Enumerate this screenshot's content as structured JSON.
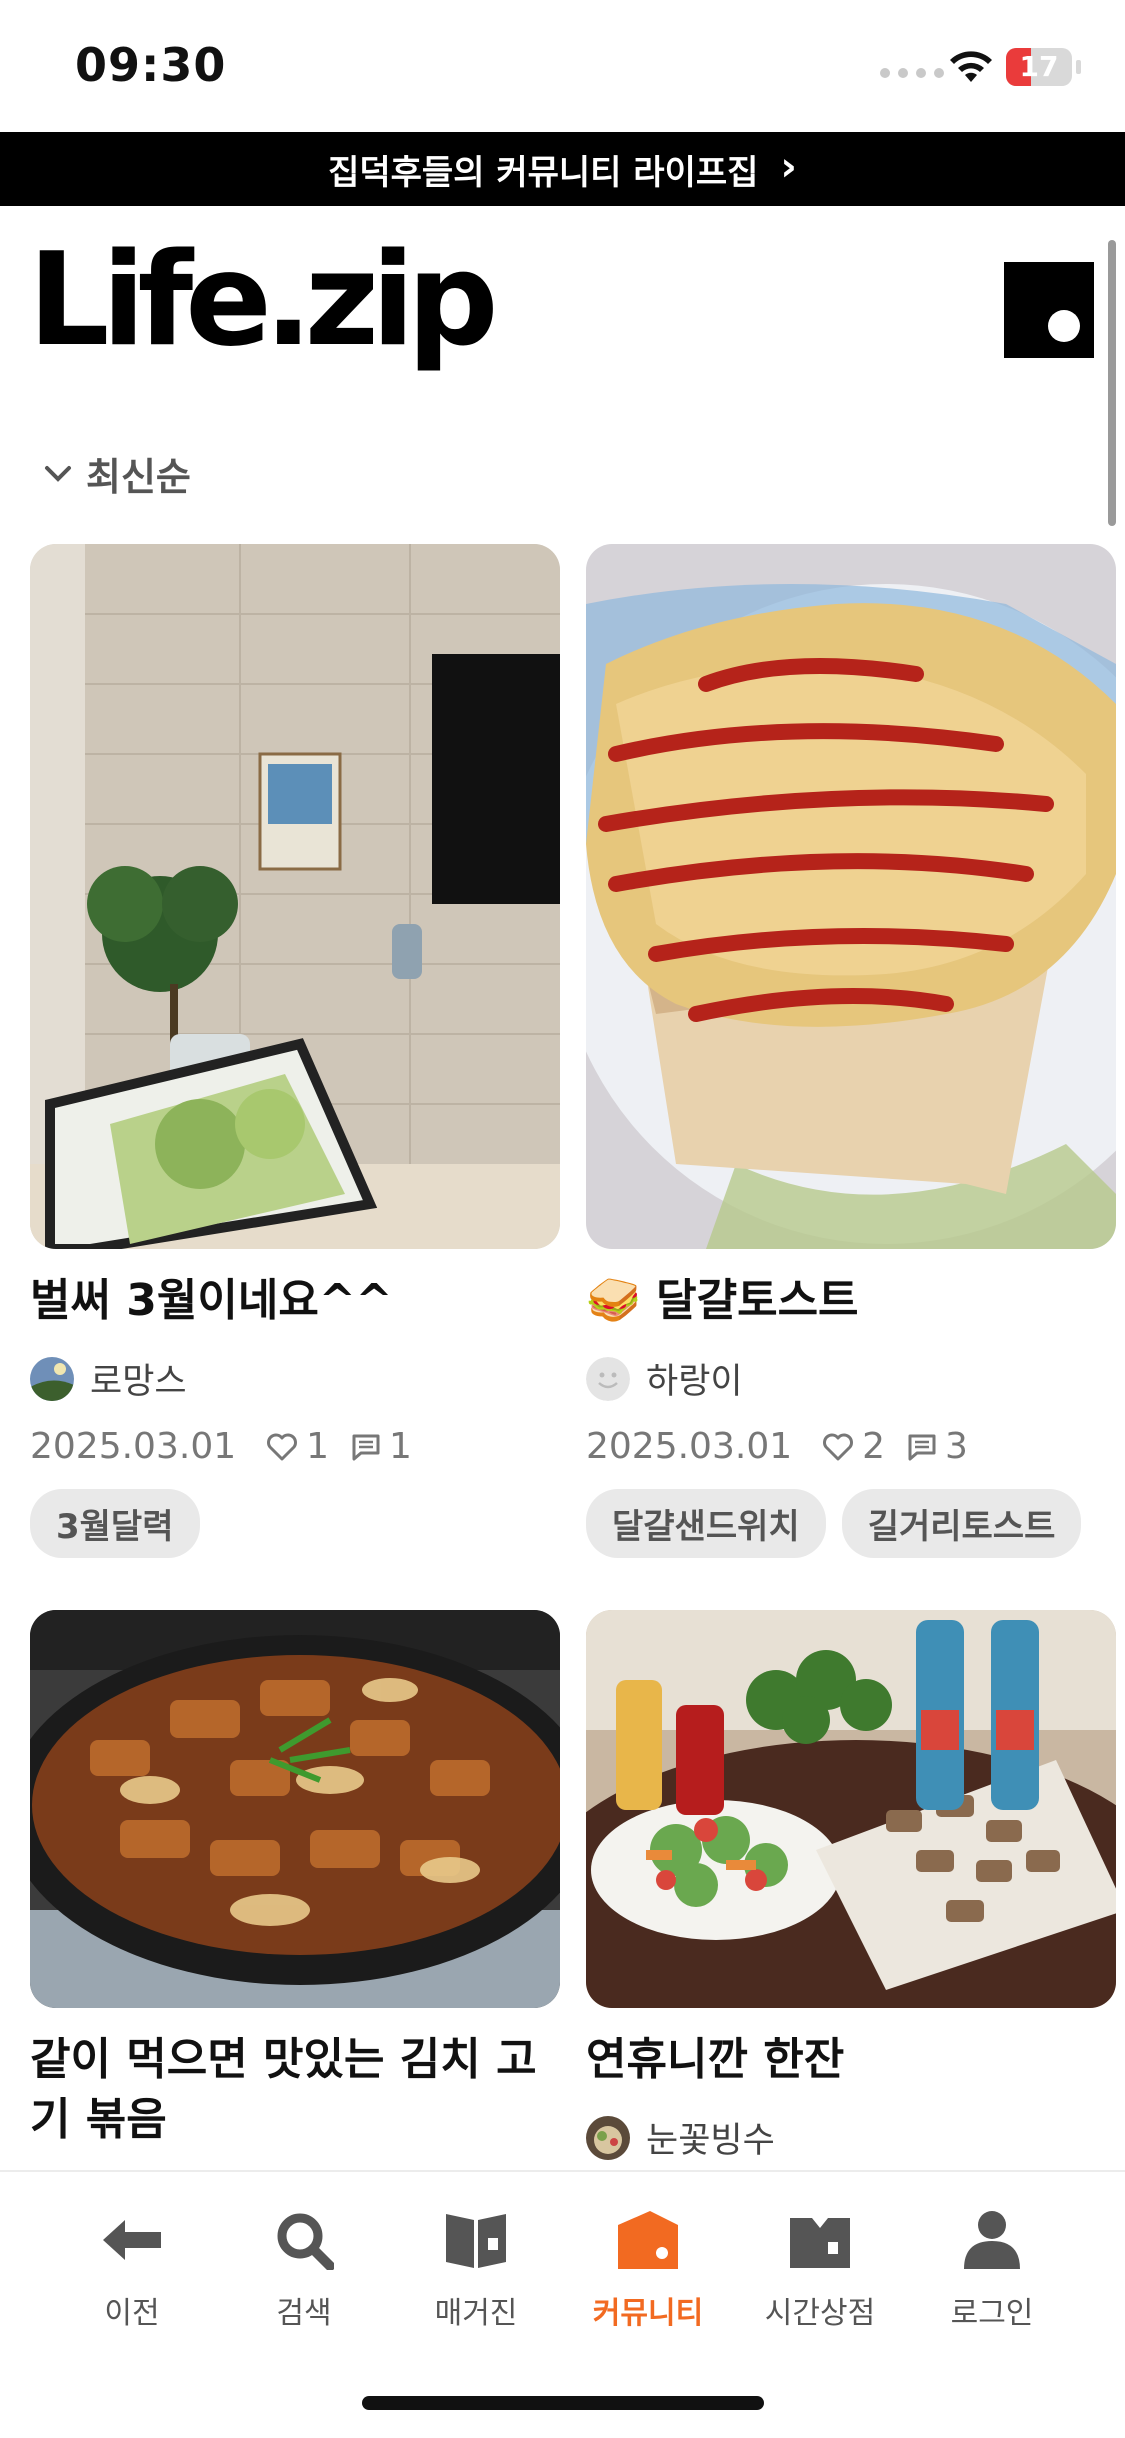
{
  "status_bar": {
    "time": "09:30",
    "battery": "17"
  },
  "banner": {
    "text": "집덕후들의 커뮤니티 라이프집",
    "chevron": "›"
  },
  "header": {
    "logo_text": "Life.zip"
  },
  "sort": {
    "label": "최신순"
  },
  "posts": [
    {
      "title": "벌써 3월이네요^^",
      "author": "로망스",
      "date": "2025.03.01",
      "likes": "1",
      "comments": "1",
      "tags": [
        "3월달력"
      ]
    },
    {
      "title_emoji": "🥪",
      "title": "달걀토스트",
      "author": "하랑이",
      "date": "2025.03.01",
      "likes": "2",
      "comments": "3",
      "tags": [
        "달걀샌드위치",
        "길거리토스트"
      ]
    },
    {
      "title": "같이 먹으면 맛있는 김치 고기 볶음"
    },
    {
      "title": "연휴니깐 한잔",
      "author": "눈꽃빙수"
    }
  ],
  "nav": {
    "items": [
      {
        "label": "이전",
        "icon": "arrow-left-icon"
      },
      {
        "label": "검색",
        "icon": "search-icon"
      },
      {
        "label": "매거진",
        "icon": "magazine-icon"
      },
      {
        "label": "커뮤니티",
        "icon": "community-icon",
        "active": true
      },
      {
        "label": "시간상점",
        "icon": "shop-icon"
      },
      {
        "label": "로그인",
        "icon": "person-icon"
      }
    ]
  },
  "colors": {
    "accent": "#f26a21",
    "banner_bg": "#000000",
    "tag_bg": "#e9e9e9"
  }
}
